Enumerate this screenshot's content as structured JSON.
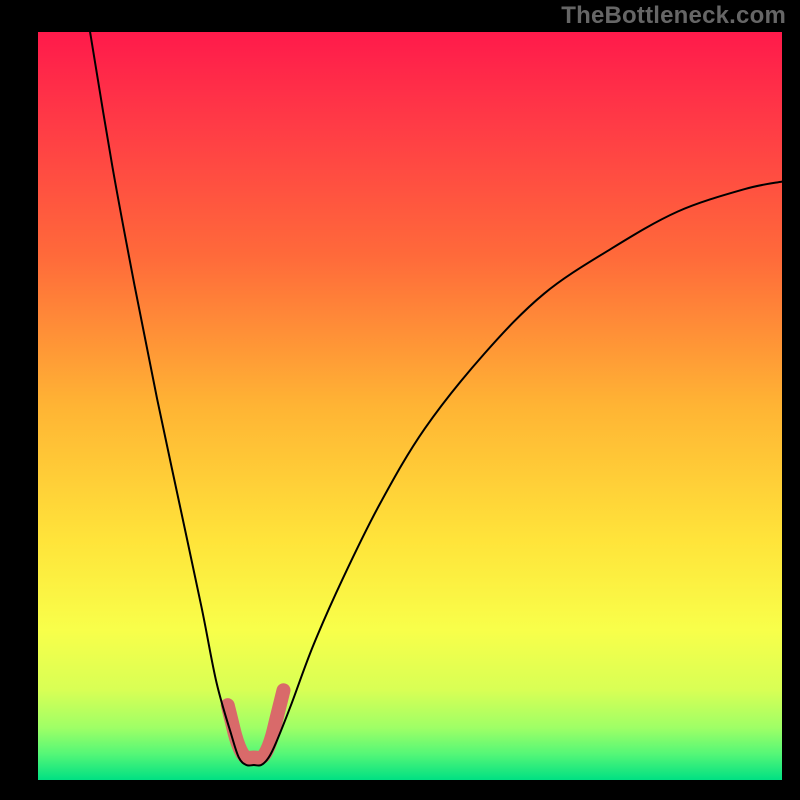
{
  "attribution": "TheBottleneck.com",
  "chart_data": {
    "type": "line",
    "title": "",
    "xlabel": "",
    "ylabel": "",
    "x_range": [
      0,
      100
    ],
    "y_range": [
      0,
      100
    ],
    "series": [
      {
        "name": "bottleneck-curve",
        "x": [
          7,
          10,
          13,
          16,
          19,
          22,
          24,
          26,
          27,
          28,
          29,
          30,
          31,
          32,
          34,
          37,
          41,
          46,
          52,
          60,
          68,
          77,
          86,
          95,
          100
        ],
        "y": [
          100,
          82,
          66,
          51,
          37,
          23,
          13,
          6,
          3,
          2,
          2,
          2,
          3,
          5,
          10,
          18,
          27,
          37,
          47,
          57,
          65,
          71,
          76,
          79,
          80
        ],
        "color": "#000000",
        "width": 2
      },
      {
        "name": "sweet-zone-marker",
        "x": [
          25.5,
          26,
          26.5,
          27,
          27.5,
          28,
          29,
          30,
          30.5,
          31,
          31.5,
          32,
          32.5,
          33
        ],
        "y": [
          10,
          8,
          6,
          4.5,
          3.5,
          3,
          3,
          3,
          3.5,
          4.5,
          6,
          8,
          10,
          12
        ],
        "color": "#d96a6a",
        "width": 14,
        "linecap": "round"
      }
    ],
    "gradient_stops": [
      {
        "pos": 0.0,
        "color": "#ff1a4b"
      },
      {
        "pos": 0.12,
        "color": "#ff3a46"
      },
      {
        "pos": 0.3,
        "color": "#ff6a3a"
      },
      {
        "pos": 0.5,
        "color": "#ffb434"
      },
      {
        "pos": 0.68,
        "color": "#ffe43a"
      },
      {
        "pos": 0.8,
        "color": "#f8ff4a"
      },
      {
        "pos": 0.88,
        "color": "#d8ff55"
      },
      {
        "pos": 0.93,
        "color": "#9fff66"
      },
      {
        "pos": 0.965,
        "color": "#55f777"
      },
      {
        "pos": 1.0,
        "color": "#00e083"
      }
    ]
  }
}
